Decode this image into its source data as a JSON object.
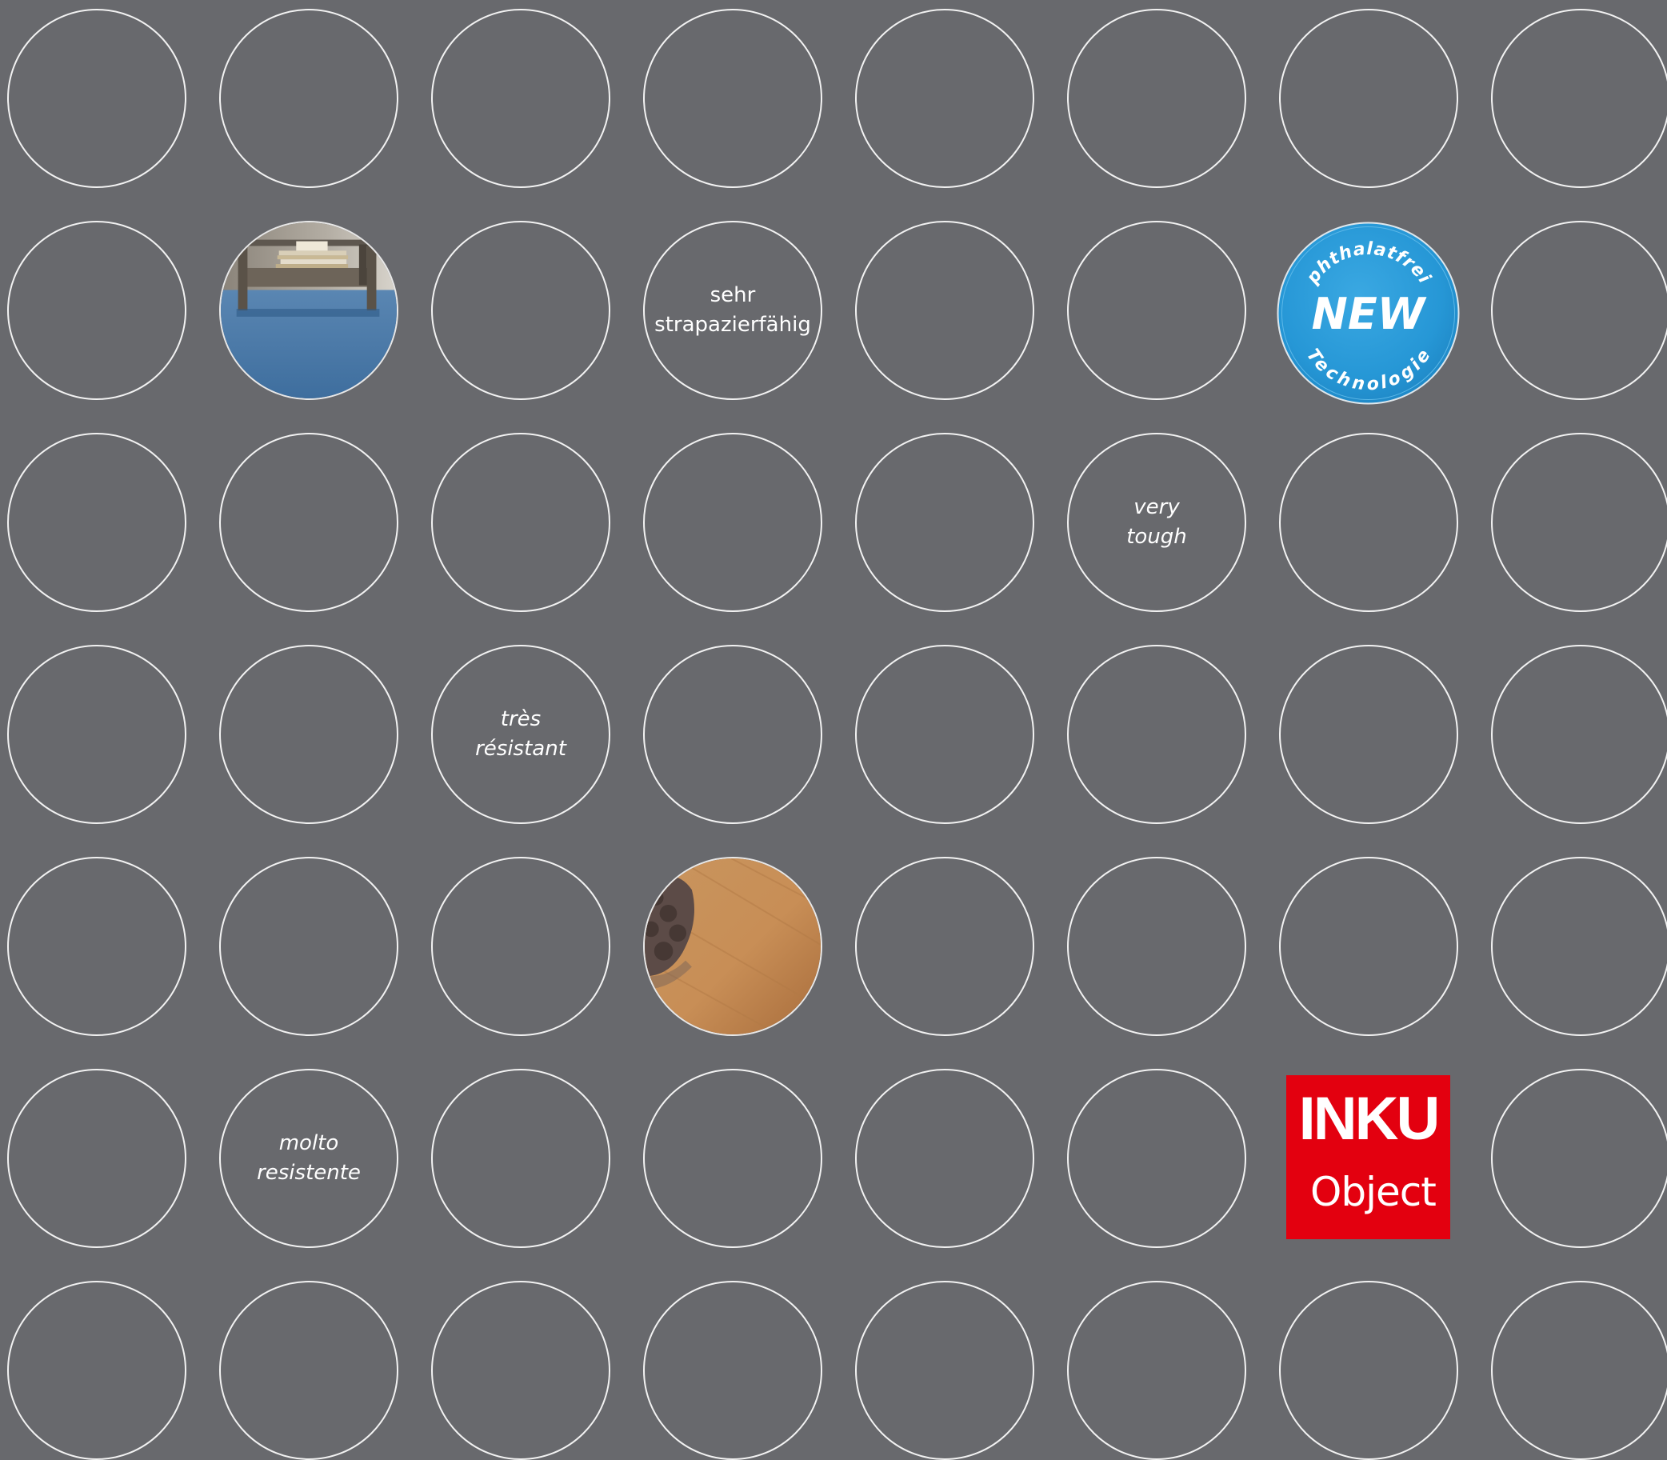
{
  "grid": {
    "rows": 7,
    "columns": 8,
    "background_color": "#68696d",
    "outline_color": "#f2f2f2"
  },
  "labels": {
    "german": [
      "sehr",
      "strapazierfähig"
    ],
    "english": [
      "very",
      "tough"
    ],
    "french": [
      "très",
      "résistant"
    ],
    "italian": [
      "molto",
      "resistente"
    ]
  },
  "photos": {
    "blue_carpet": "photo of blue carpet floor with low bookshelf",
    "wood_floor": "photo of wooden floor with brown cushion"
  },
  "badge": {
    "top_text": "phthalatfrei",
    "main_text": "NEW",
    "bottom_text": "Technologie",
    "color": "#2e9ad8"
  },
  "logo": {
    "brand": "INKU",
    "subtitle": "Object",
    "color": "#e3000f"
  }
}
